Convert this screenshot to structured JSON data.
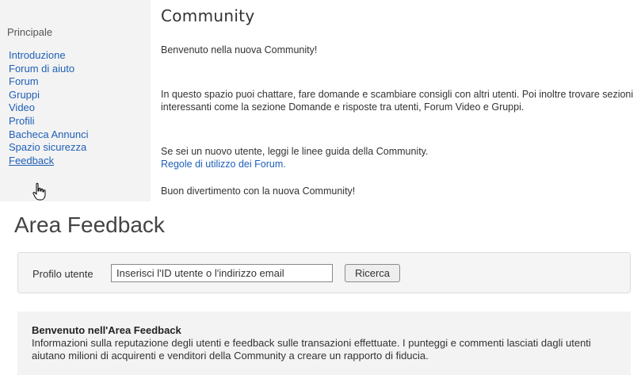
{
  "sidebar": {
    "heading": "Principale",
    "items": [
      {
        "label": "Introduzione"
      },
      {
        "label": "Forum di aiuto"
      },
      {
        "label": "Forum"
      },
      {
        "label": "Gruppi"
      },
      {
        "label": "Video"
      },
      {
        "label": "Profili"
      },
      {
        "label": "Bacheca Annunci"
      },
      {
        "label": "Spazio sicurezza"
      },
      {
        "label": "Feedback"
      }
    ]
  },
  "main": {
    "title": "Community",
    "welcome": "Benvenuto nella nuova Community!",
    "space_text": "In questo spazio puoi chattare, fare domande e scambiare consigli con altri utenti. Poi inoltre trovare sezioni interessanti come la sezione Domande e risposte tra utenti, Forum Video e Gruppi.",
    "guide_text": "Se sei un nuovo utente, leggi le linee guida della Community.",
    "rules_link": "Regole di utilizzo dei Forum.",
    "fun_text": "Buon divertimento con la nuova Community!"
  },
  "feedback": {
    "title": "Area Feedback",
    "search": {
      "label": "Profilo utente",
      "value": "Inserisci l'ID utente o l'indirizzo email",
      "button": "Ricerca"
    },
    "welcome_heading": "Benvenuto nell'Area Feedback",
    "welcome_text": "Informazioni sulla reputazione degli utenti e feedback sulle transazioni effettuate. I punteggi e commenti lasciati dagli utenti aiutano milioni di acquirenti e venditori della Community a creare un rapporto di fiducia."
  }
}
